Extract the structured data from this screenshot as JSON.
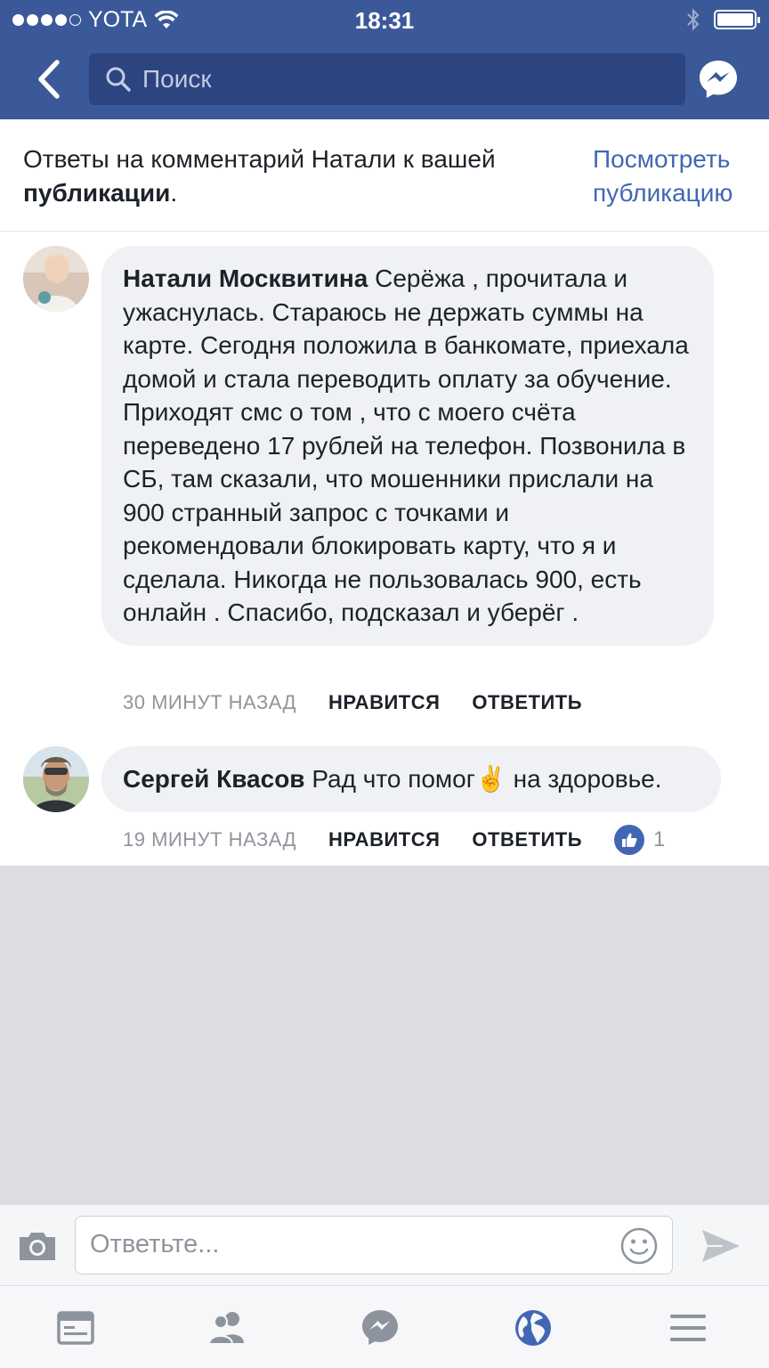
{
  "status_bar": {
    "carrier": "YOTA",
    "time": "18:31"
  },
  "nav": {
    "search_placeholder": "Поиск"
  },
  "header": {
    "text_prefix": "Ответы на комментарий Натали к вашей ",
    "text_bold": "публикации",
    "text_suffix": ".",
    "view_post_link": "Посмотреть публикацию"
  },
  "comments": [
    {
      "author": "Натали Москвитина",
      "text": "Серёжа , прочитала и ужаснулась. Стараюсь не держать суммы на карте. Сегодня положила в банкомате, приехала домой и стала переводить оплату за обучение. Приходят смс о том , что с моего счёта переведено 17 рублей на телефон. Позвонила в СБ, там сказали, что мошенники прислали на 900 странный запрос с точками и рекомендовали блокировать карту, что я и сделала. Никогда не пользовалась 900, есть онлайн . Спасибо, подсказал и уберёг .",
      "time": "30 МИНУТ НАЗАД",
      "like_label": "НРАВИТСЯ",
      "reply_label": "ОТВЕТИТЬ"
    },
    {
      "author": "Сергей Квасов",
      "text": "Рад что помог✌️ на здоровье.",
      "time": "19 МИНУТ НАЗАД",
      "like_label": "НРАВИТСЯ",
      "reply_label": "ОТВЕТИТЬ",
      "like_count": "1"
    }
  ],
  "reply_bar": {
    "placeholder": "Ответьте..."
  },
  "colors": {
    "brand": "#3b5998",
    "link": "#4267b2",
    "bubble": "#f0f1f4",
    "muted": "#90949c"
  },
  "icons": {
    "back": "chevron-left-icon",
    "search": "search-icon",
    "messenger": "messenger-icon",
    "camera": "camera-icon",
    "emoji": "smiley-icon",
    "send": "send-icon",
    "tabs": [
      "news-feed-icon",
      "friends-icon",
      "messenger-icon",
      "notifications-globe-icon",
      "menu-icon"
    ]
  }
}
